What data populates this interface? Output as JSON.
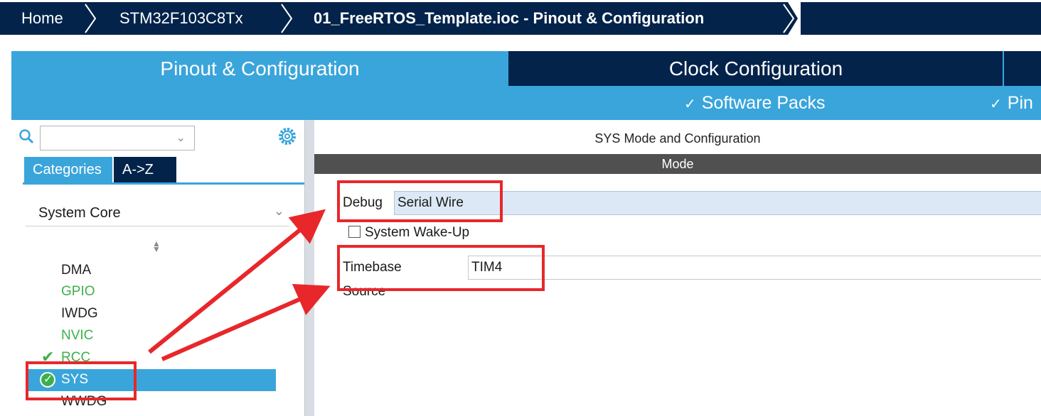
{
  "breadcrumb": {
    "items": [
      "Home",
      "STM32F103C8Tx",
      "01_FreeRTOS_Template.ioc - Pinout & Configuration"
    ]
  },
  "tabs": {
    "pinout": "Pinout & Configuration",
    "clock": "Clock Configuration"
  },
  "subbar": {
    "software_packs": "Software Packs",
    "pinout": "Pin"
  },
  "left": {
    "search_value": "",
    "tab_categories": "Categories",
    "tab_az": "A->Z",
    "group": "System Core",
    "items": [
      {
        "label": "DMA",
        "state": "normal"
      },
      {
        "label": "GPIO",
        "state": "green"
      },
      {
        "label": "IWDG",
        "state": "normal"
      },
      {
        "label": "NVIC",
        "state": "green"
      },
      {
        "label": "RCC",
        "state": "checked"
      },
      {
        "label": "SYS",
        "state": "selected"
      },
      {
        "label": "WWDG",
        "state": "normal"
      }
    ]
  },
  "right": {
    "title": "SYS Mode and Configuration",
    "mode_header": "Mode",
    "debug_label": "Debug",
    "debug_value": "Serial Wire",
    "wake_label": "System Wake-Up",
    "timebase_label": "Timebase Source",
    "timebase_value": "TIM4"
  },
  "colors": {
    "navy": "#03234b",
    "accent_blue": "#3aa5db",
    "status_green": "#3cb049",
    "annotation_red": "#e8272b"
  }
}
